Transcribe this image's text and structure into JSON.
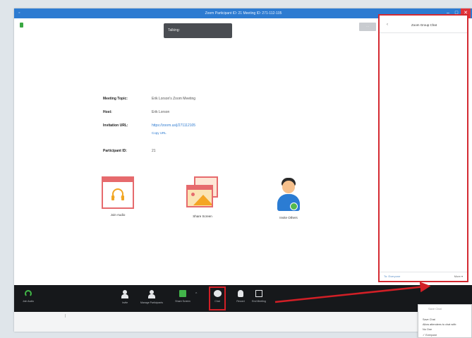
{
  "window": {
    "title": "Zoom Participant ID: 21 Meeting ID: 271-112-105",
    "controls": [
      "–",
      "□",
      "✕"
    ]
  },
  "top": {
    "talking_label": "Talking:",
    "grey_tab_label": "···"
  },
  "meeting_info": [
    {
      "label": "Meeting Topic:",
      "value": "Erik Lorson's Zoom Meeting"
    },
    {
      "label": "Host:",
      "value": "Erik Lorson"
    },
    {
      "label": "Invitation URL:",
      "value": "https://zoom.us/j/271112105",
      "sub": "Copy URL"
    },
    {
      "label": "Participant ID:",
      "value": "21"
    }
  ],
  "actions": [
    {
      "label": "Join Audio"
    },
    {
      "label": "Share Screen"
    },
    {
      "label": "Invite Others"
    }
  ],
  "toolbar": {
    "audio": "Join Audio",
    "invite": "Invite",
    "manage": "Manage Participants",
    "share": "Share Screen",
    "chat": "Chat",
    "record": "Record",
    "end": "End Meeting"
  },
  "chat": {
    "back": "‹",
    "title": "Zoom Group Chat",
    "to_label": "To: Everyone",
    "more": "More ▾"
  },
  "popup": {
    "title": "Save Chat",
    "items": [
      "Save Chat",
      "Allow attendees to chat with:",
      "No One",
      "✓ Everyone"
    ]
  },
  "colors": {
    "accent": "#2d7bd1",
    "highlight": "#d21f26"
  }
}
